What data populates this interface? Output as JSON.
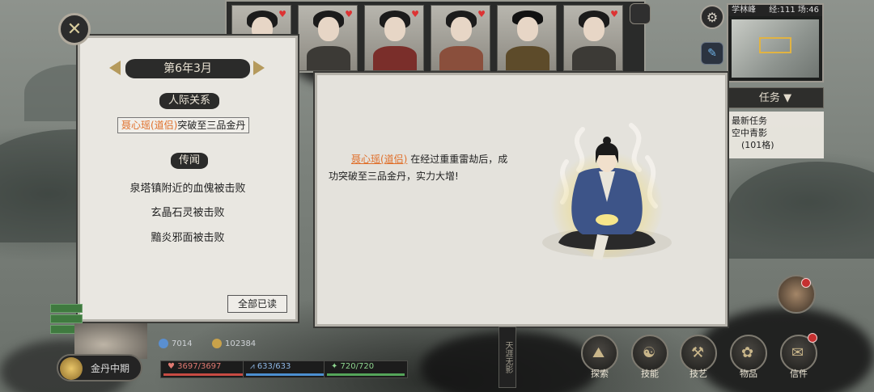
{
  "date": "第6年3月",
  "sections": {
    "relations_title": "人际关系",
    "rumors_title": "传闻"
  },
  "relation_entry": {
    "name": "聂心瑶(道侣)",
    "event": "突破至三品金丹"
  },
  "rumors": [
    "泉塔镇附近的血傀被击败",
    "玄晶石灵被击败",
    "黯炎邪面被击败"
  ],
  "read_all_button": "全部已读",
  "detail": {
    "name": "聂心瑶(道侣)",
    "text": "在经过重重雷劫后，成功突破至三品金丹，实力大增!"
  },
  "minimap": {
    "header": "学林峰",
    "time": "经:111 场:46"
  },
  "tasks": {
    "title": "任务",
    "items": [
      "最新任务",
      "空中青影",
      "(101格)"
    ]
  },
  "player": {
    "realm": "金丹中期",
    "tags": [
      "",
      "",
      ""
    ]
  },
  "resources": [
    {
      "icon": "spirit-stone-icon",
      "value": "7014",
      "color": "#5a8fd0"
    },
    {
      "icon": "gold-coin-icon",
      "value": "102384",
      "color": "#c9a24a"
    }
  ],
  "stats": [
    {
      "icon": "heart-icon",
      "label": "♥ 3697/3697",
      "color": "#c84b43"
    },
    {
      "icon": "mana-icon",
      "label": "⩘ 633/633",
      "color": "#4c8fd0"
    },
    {
      "icon": "stamina-icon",
      "label": "✦ 720/720",
      "color": "#55a55a"
    }
  ],
  "vertical_plaque": "天涯无影",
  "menu": [
    {
      "label": "探索",
      "icon": "explore-icon",
      "glyph": "⛰"
    },
    {
      "label": "技能",
      "icon": "skill-icon",
      "glyph": "☯"
    },
    {
      "label": "技艺",
      "icon": "craft-icon",
      "glyph": "⚒"
    },
    {
      "label": "物品",
      "icon": "item-icon",
      "glyph": "✿"
    },
    {
      "label": "信件",
      "icon": "letter-icon",
      "glyph": "✉"
    }
  ],
  "portraits": [
    {
      "name": "",
      "heart": "♥"
    },
    {
      "name": "",
      "heart": "♥"
    },
    {
      "name": "",
      "heart": "♥"
    },
    {
      "name": "",
      "heart": "♥"
    },
    {
      "name": "",
      "heart": ""
    },
    {
      "name": "",
      "heart": "♥"
    }
  ],
  "colors": {
    "accent_orange": "#e06f2a",
    "panel_bg": "#e9e7e1",
    "ink_dark": "#2b2b2a"
  }
}
